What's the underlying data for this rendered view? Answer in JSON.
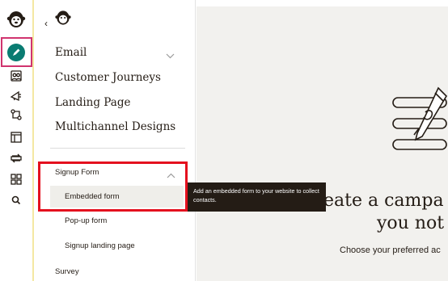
{
  "rail": {
    "items": [
      {
        "name": "logo-icon"
      },
      {
        "name": "create-icon"
      },
      {
        "name": "audience-icon"
      },
      {
        "name": "campaigns-icon"
      },
      {
        "name": "automations-icon"
      },
      {
        "name": "website-icon"
      },
      {
        "name": "content-icon"
      },
      {
        "name": "integrations-icon"
      },
      {
        "name": "search-icon"
      }
    ],
    "accent": "#0a7c72",
    "highlight": "#d0336e"
  },
  "panel": {
    "back_label": "‹",
    "nav_items": [
      {
        "label": "Email"
      },
      {
        "label": "Customer Journeys"
      },
      {
        "label": "Landing Page"
      },
      {
        "label": "Multichannel Designs"
      }
    ],
    "signup": {
      "label": "Signup Form",
      "items": [
        {
          "label": "Embedded form"
        },
        {
          "label": "Pop-up form"
        },
        {
          "label": "Signup landing page"
        }
      ]
    },
    "survey_label": "Survey"
  },
  "tooltip": {
    "text": "Add an embedded form to your website to collect contacts."
  },
  "main": {
    "headline_line1": "eate a campa",
    "headline_line2": "you not",
    "subtext": "Choose your preferred ac"
  },
  "colors": {
    "annotation_red": "#e4101e",
    "tooltip_bg": "#241c15",
    "main_bg": "#f2f1ee"
  }
}
